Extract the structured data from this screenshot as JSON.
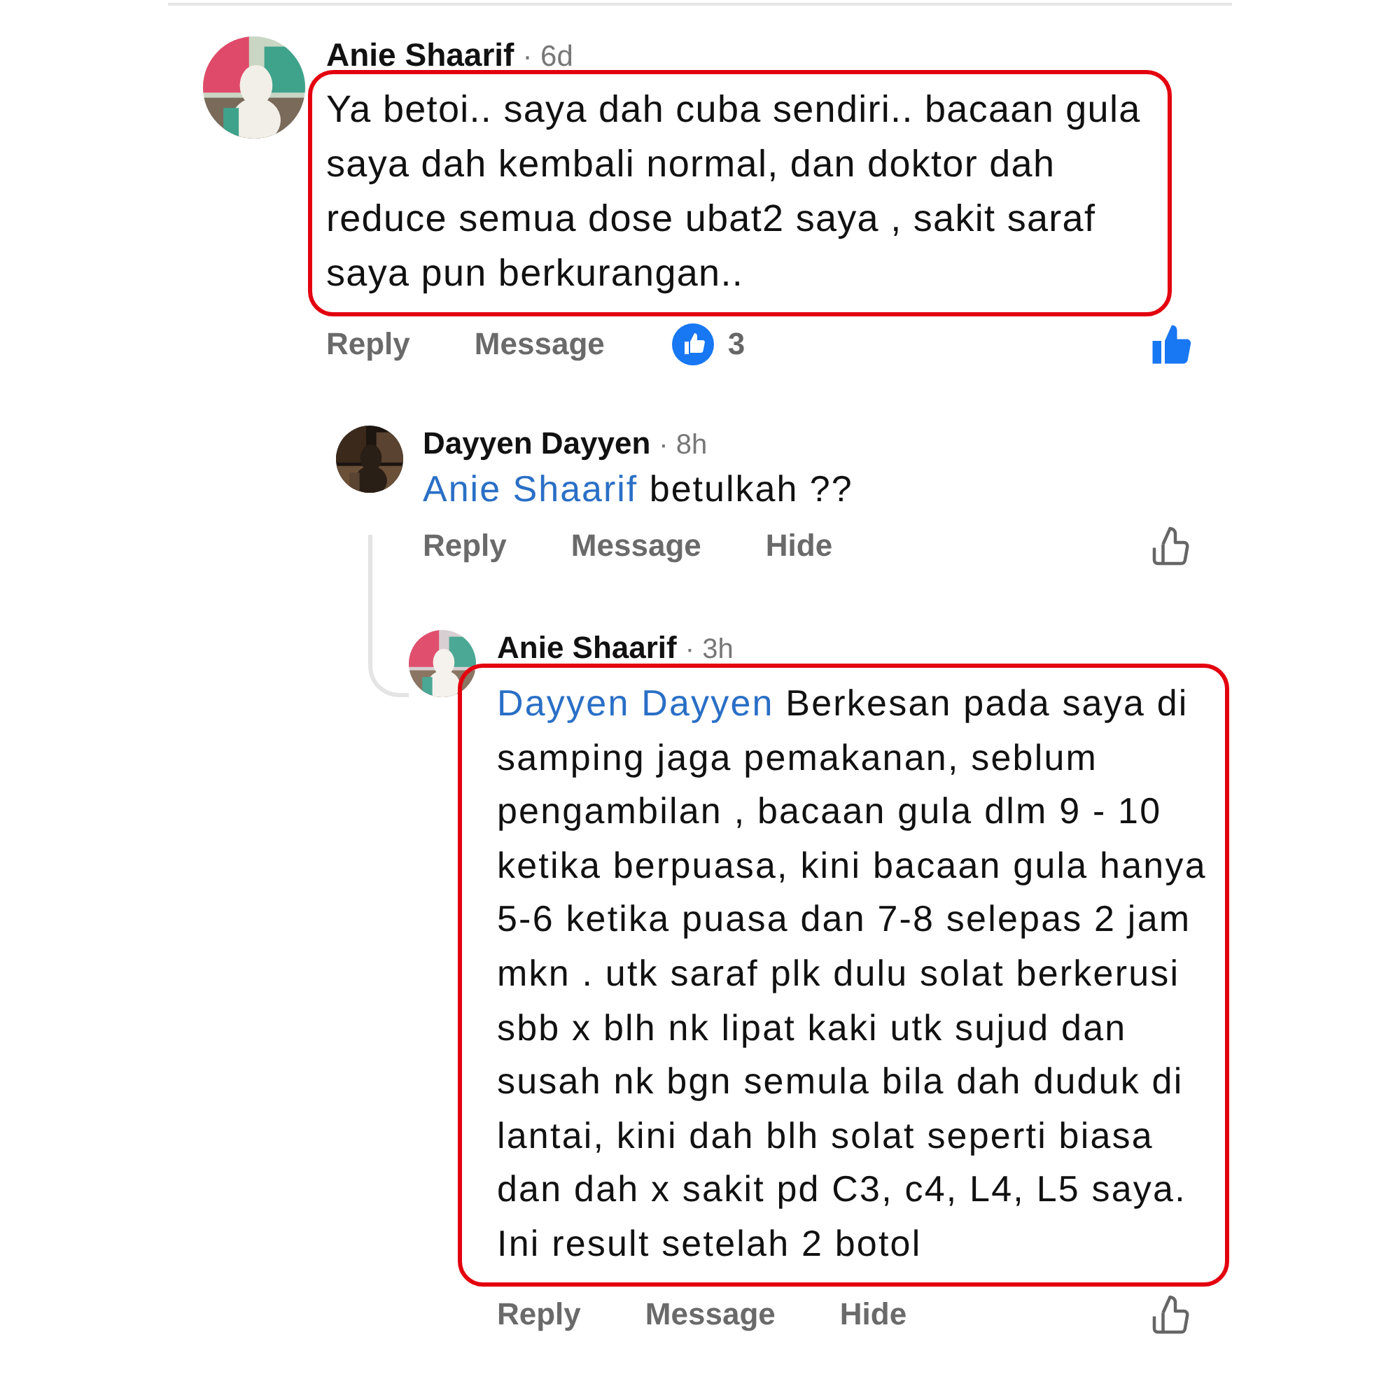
{
  "comments": [
    {
      "author": "Anie Shaarif",
      "time": "· 6d",
      "text": "Ya betoi.. saya dah cuba sendiri.. bacaan gula saya dah kembali normal, dan doktor dah reduce semua dose ubat2 saya , sakit saraf saya pun berkurangan..",
      "highlighted": true,
      "actions": [
        "Reply",
        "Message"
      ],
      "reactions": "3",
      "liked": true,
      "replies": [
        {
          "author": "Dayyen Dayyen",
          "time": "· 8h",
          "mention": "Anie Shaarif",
          "text": "betulkah ??",
          "highlighted": false,
          "actions": [
            "Reply",
            "Message",
            "Hide"
          ],
          "liked": false,
          "replies": [
            {
              "author": "Anie Shaarif",
              "time": "· 3h",
              "mention": "Dayyen Dayyen",
              "text": "Berkesan pada saya di samping jaga pemakanan, seblum pengambilan , bacaan gula dlm 9 - 10 ketika berpuasa, kini bacaan gula hanya 5-6 ketika puasa dan 7-8 selepas 2 jam mkn .  utk saraf plk dulu solat berkerusi sbb x blh nk lipat kaki utk sujud dan susah nk bgn semula bila dah duduk di lantai, kini dah blh solat seperti biasa dan dah x sakit pd C3, c4, L4, L5 saya. Ini result setelah 2 botol",
              "highlighted": true,
              "actions": [
                "Reply",
                "Message",
                "Hide"
              ],
              "liked": false
            }
          ]
        }
      ]
    }
  ]
}
